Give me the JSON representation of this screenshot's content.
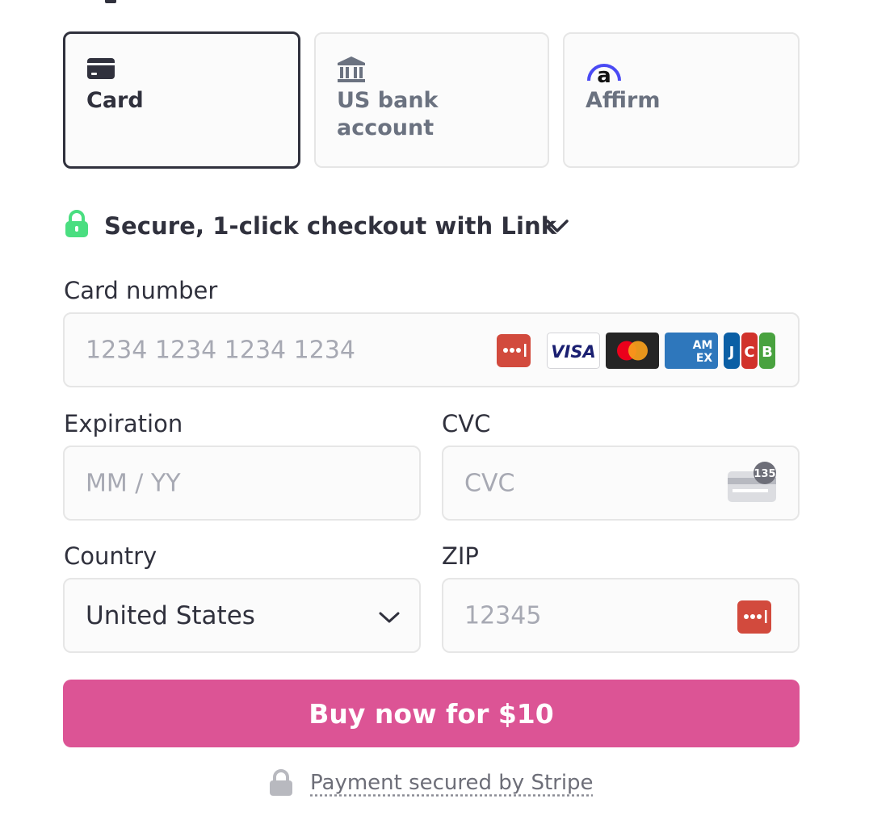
{
  "payment_methods": [
    {
      "label": "Card",
      "icon": "credit-card-icon",
      "selected": true
    },
    {
      "label_line1": "US bank",
      "label_line2": "account",
      "icon": "bank-icon",
      "selected": false
    },
    {
      "label": "Affirm",
      "icon": "affirm-logo-icon",
      "selected": false
    }
  ],
  "link": {
    "text": "Secure, 1-click checkout with Link",
    "icon": "lock-icon",
    "accent": "#4ade80"
  },
  "card_number": {
    "label": "Card number",
    "placeholder": "1234 1234 1234 1234",
    "brands": [
      "VISA",
      "mastercard",
      "AMEX",
      "JCB"
    ]
  },
  "expiration": {
    "label": "Expiration",
    "placeholder": "MM / YY"
  },
  "cvc": {
    "label": "CVC",
    "placeholder": "CVC",
    "badge": "135"
  },
  "country": {
    "label": "Country",
    "value": "United States"
  },
  "zip": {
    "label": "ZIP",
    "placeholder": "12345"
  },
  "buy_button": {
    "label": "Buy now for $10",
    "color": "#dc5495"
  },
  "footer": {
    "text": "Payment secured by Stripe"
  }
}
